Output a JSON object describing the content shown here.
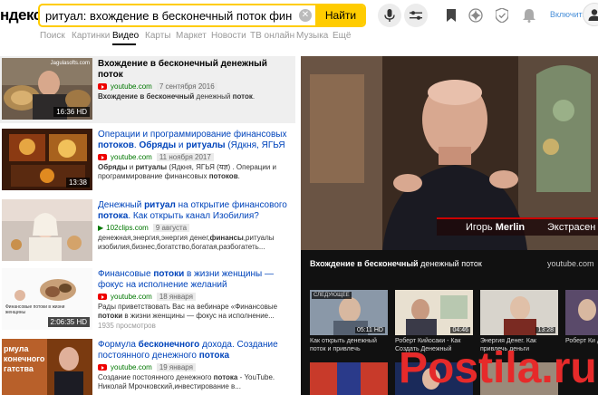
{
  "header": {
    "logo": "ндекс",
    "search_value": "ритуал: вхождение в бесконечный поток финансов.ви",
    "clear_glyph": "✕",
    "find_label": "Найти",
    "login_label": "Включить"
  },
  "tabs": [
    {
      "label": "Поиск"
    },
    {
      "label": "Картинки"
    },
    {
      "label": "Видео"
    },
    {
      "label": "Карты"
    },
    {
      "label": "Маркет"
    },
    {
      "label": "Новости"
    },
    {
      "label": "ТВ онлайн"
    },
    {
      "label": "Музыка"
    },
    {
      "label": "Ещё"
    }
  ],
  "results": [
    {
      "title_parts": [
        "Вхождение в бесконечный денежный поток"
      ],
      "source": "youtube.com",
      "date": "7 сентября 2016",
      "desc": "Вхождение в бесконечный денежный поток.",
      "duration": "16:36 HD",
      "thumb_label": "Jagulasofts.com"
    },
    {
      "title": "Операции и программирование финансовых потоков. Обряды и ритуалы (Ядкня, ЯГЬЯ",
      "source": "youtube.com",
      "date": "11 ноября 2017",
      "desc": "Обряды и ритуалы (Ядкня, ЯГЬЯ (यज्ञ) . Операции и программирование финансовых потоков.",
      "duration": "13:38"
    },
    {
      "title": "Денежный ритуал на открытие финансового потока. Как открыть канал Изобилия?",
      "source": "102clips.com",
      "date": "9 августа",
      "desc": "денежная,энергия,энергия денег,финансы,ритуалы изобилия,бизнес,богатство,богатая,разбогатеть..."
    },
    {
      "title": "Финансовые потоки в жизни женщины — фокус на исполнение желаний",
      "source": "youtube.com",
      "date": "18 января",
      "desc": "Рады приветствовать Вас на вебинаре «Финансовые потоки в жизни женщины — фокус на исполнение...",
      "views": "1935 просмотров",
      "duration": "2:06:35 HD",
      "thumb_caption": "Финансовые потоки в жизни женщины"
    },
    {
      "title": "Формула бесконечного дохода. Создание постоянного денежного потока",
      "source": "youtube.com",
      "date": "19 января",
      "desc": "Создание постоянного денежного потока - YouTube. Николай Мрочковский,инвестирование в...",
      "thumb_text": "рмула\nконечного\nгатства"
    }
  ],
  "player": {
    "lower_name_first": "Игорь",
    "lower_name_last": "Merlin",
    "lower_title": "Экстрасен",
    "now_title_bold": "Вхождение в бесконечный",
    "now_title_rest": " денежный поток",
    "now_source": "youtube.com",
    "related": [
      {
        "badge": "СЛЕДУЮЩЕЕ",
        "duration": "05:11 HD",
        "title": "Как открыть денежный поток и привлечь"
      },
      {
        "duration": "04:46",
        "title": "Роберт Кийосаки - Как Создать Денежный"
      },
      {
        "duration": "13:28",
        "title": "Энергия Денег. Как привлечь деньги"
      },
      {
        "title": "Роберт Ки деньги, вр"
      }
    ]
  },
  "watermark": "Postila.ru",
  "colors": {
    "accent": "#ffcc00",
    "link": "#0044bb",
    "source_green": "#007700"
  }
}
